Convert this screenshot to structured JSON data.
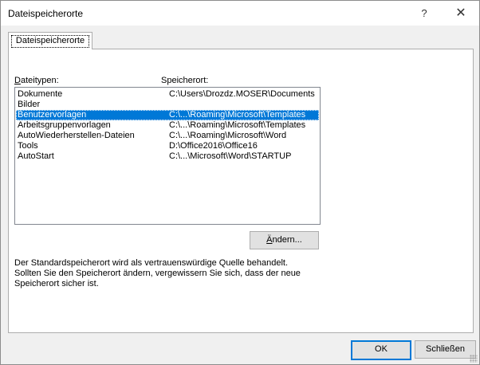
{
  "window": {
    "title": "Dateispeicherorte",
    "help_label": "?",
    "close_label": "✕"
  },
  "tab": {
    "label": "Dateispeicherorte"
  },
  "columns": {
    "type_header_prefix": "",
    "type_header_accel": "D",
    "type_header_rest": "ateitypen:",
    "location_header": "Speicherort:"
  },
  "rows": [
    {
      "type": "Dokumente",
      "location": "C:\\Users\\Drozdz.MOSER\\Documents"
    },
    {
      "type": "Bilder",
      "location": ""
    },
    {
      "type": "Benutzervorlagen",
      "location": "C:\\...\\Roaming\\Microsoft\\Templates"
    },
    {
      "type": "Arbeitsgruppenvorlagen",
      "location": "C:\\...\\Roaming\\Microsoft\\Templates"
    },
    {
      "type": "AutoWiederherstellen-Dateien",
      "location": "C:\\...\\Roaming\\Microsoft\\Word"
    },
    {
      "type": "Tools",
      "location": "D:\\Office2016\\Office16"
    },
    {
      "type": "AutoStart",
      "location": "C:\\...\\Microsoft\\Word\\STARTUP"
    }
  ],
  "selected_row_index": 2,
  "change_button": {
    "accel": "Ä",
    "rest": "ndern..."
  },
  "info_lines": [
    "Der Standardspeicherort wird als vertrauenswürdige Quelle behandelt.",
    "Sollten Sie den Speicherort ändern, vergewissern Sie sich, dass der neue",
    "Speicherort sicher ist."
  ],
  "footer": {
    "ok_label": "OK",
    "close_label": "Schließen"
  },
  "colors": {
    "selection": "#0078d7",
    "default_button_border": "#0078d7"
  }
}
